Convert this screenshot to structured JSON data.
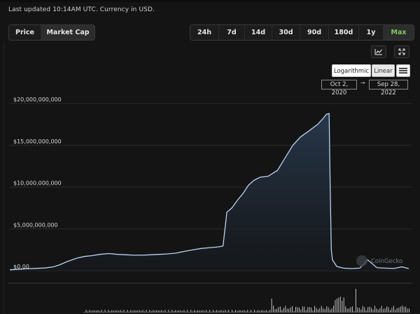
{
  "header": {
    "updated": "Last updated 10:14AM UTC. Currency in USD."
  },
  "metric_tabs": [
    {
      "label": "Price",
      "active": false
    },
    {
      "label": "Market Cap",
      "active": true
    }
  ],
  "range_tabs": [
    {
      "label": "24h",
      "active": false
    },
    {
      "label": "7d",
      "active": false
    },
    {
      "label": "14d",
      "active": false
    },
    {
      "label": "30d",
      "active": false
    },
    {
      "label": "90d",
      "active": false
    },
    {
      "label": "180d",
      "active": false
    },
    {
      "label": "1y",
      "active": false
    },
    {
      "label": "Max",
      "active": true
    }
  ],
  "chart_tools": {
    "line_icon": "line-chart-icon",
    "fullscreen_icon": "fullscreen-icon",
    "menu_icon": "hamburger-menu-icon"
  },
  "scale": {
    "log_label": "Logarithmic",
    "linear_label": "Linear",
    "selected": "Linear"
  },
  "date_range": {
    "from": "Oct 2, 2020",
    "arrow": "→",
    "to": "Sep 28, 2022"
  },
  "watermark": "CoinGecko",
  "colors": {
    "line": "#b9d3f2",
    "green_active": "#7ecb5b",
    "background": "#141414"
  },
  "chart_data": {
    "type": "area",
    "y_tick_labels": [
      "$0.00",
      "$5,000,000,000",
      "$10,000,000,000",
      "$15,000,000,000",
      "$20,000,000,000"
    ],
    "y_ticks": [
      0,
      5000000000,
      10000000000,
      15000000000,
      20000000000
    ],
    "ylim": [
      0,
      20000000000
    ],
    "xlim": [
      "2020-10-02",
      "2022-09-28"
    ],
    "grid": true,
    "series": [
      {
        "x": [
          "2020-10-02",
          "2020-10-15",
          "2020-11-01",
          "2020-11-20",
          "2020-12-05",
          "2020-12-20",
          "2021-01-01",
          "2021-01-15",
          "2021-02-01",
          "2021-02-15",
          "2021-03-01",
          "2021-03-15",
          "2021-04-01",
          "2021-04-15",
          "2021-05-01",
          "2021-05-15",
          "2021-06-01",
          "2021-06-15",
          "2021-07-01",
          "2021-07-15",
          "2021-08-01",
          "2021-08-15",
          "2021-09-01",
          "2021-09-15",
          "2021-10-01",
          "2021-10-10",
          "2021-10-18",
          "2021-10-25",
          "2021-11-01",
          "2021-11-10",
          "2021-11-20",
          "2021-12-01",
          "2021-12-10",
          "2021-12-20",
          "2022-01-01",
          "2022-01-15",
          "2022-02-01",
          "2022-02-15",
          "2022-03-01",
          "2022-03-15",
          "2022-04-01",
          "2022-04-15",
          "2022-04-25",
          "2022-05-01",
          "2022-05-06",
          "2022-05-08",
          "2022-05-10",
          "2022-05-12",
          "2022-05-20",
          "2022-06-01",
          "2022-06-15",
          "2022-07-01",
          "2022-07-15",
          "2022-08-01",
          "2022-08-15",
          "2022-09-01",
          "2022-09-15",
          "2022-09-28"
        ],
        "values": [
          100000000,
          150000000,
          220000000,
          280000000,
          320000000,
          450000000,
          700000000,
          1100000000,
          1500000000,
          1700000000,
          1800000000,
          1950000000,
          2050000000,
          1950000000,
          1900000000,
          1850000000,
          1850000000,
          1900000000,
          1950000000,
          2000000000,
          2100000000,
          2300000000,
          2500000000,
          2650000000,
          2750000000,
          2800000000,
          2850000000,
          2950000000,
          7000000000,
          7500000000,
          8400000000,
          9300000000,
          10200000000,
          10800000000,
          11200000000,
          11300000000,
          12000000000,
          13500000000,
          15000000000,
          16000000000,
          16800000000,
          17500000000,
          18200000000,
          18700000000,
          18800000000,
          10000000000,
          2500000000,
          1300000000,
          500000000,
          300000000,
          250000000,
          300000000,
          1300000000,
          350000000,
          300000000,
          260000000,
          450000000,
          250000000
        ]
      }
    ]
  }
}
